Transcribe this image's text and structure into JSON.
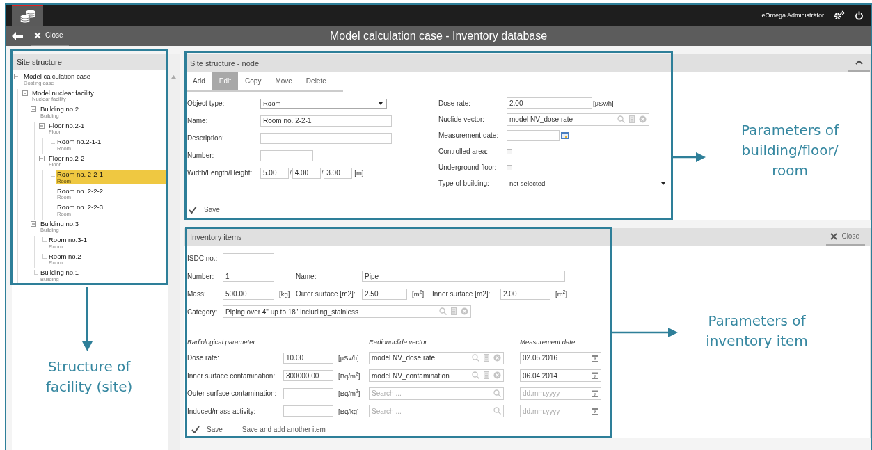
{
  "header": {
    "user": "eOmega Administrátor"
  },
  "toolbar": {
    "close_label": "Close",
    "title": "Model calculation case - Inventory database"
  },
  "tree_panel": {
    "title": "Site structure",
    "nodes": [
      {
        "label": "Model calculation case",
        "type": "Costing case",
        "expanded": true,
        "selected": false,
        "children": [
          {
            "label": "Model nuclear facility",
            "type": "Nuclear facility",
            "expanded": true,
            "selected": false,
            "children": [
              {
                "label": "Building no.2",
                "type": "Building",
                "expanded": true,
                "selected": false,
                "children": [
                  {
                    "label": "Floor no.2-1",
                    "type": "Floor",
                    "expanded": true,
                    "selected": false,
                    "children": [
                      {
                        "label": "Room no.2-1-1",
                        "type": "Room",
                        "selected": false
                      }
                    ]
                  },
                  {
                    "label": "Floor no.2-2",
                    "type": "Floor",
                    "expanded": true,
                    "selected": false,
                    "children": [
                      {
                        "label": "Room no. 2-2-1",
                        "type": "Room",
                        "selected": true
                      },
                      {
                        "label": "Room no. 2-2-2",
                        "type": "Room",
                        "selected": false
                      },
                      {
                        "label": "Room no. 2-2-3",
                        "type": "Room",
                        "selected": false
                      }
                    ]
                  }
                ]
              },
              {
                "label": "Building no.3",
                "type": "Building",
                "expanded": true,
                "selected": false,
                "children": [
                  {
                    "label": "Room no.3-1",
                    "type": "Room",
                    "selected": false
                  },
                  {
                    "label": "Room no.2",
                    "type": "Room",
                    "selected": false
                  }
                ]
              },
              {
                "label": "Building no.1",
                "type": "Building",
                "selected": false
              }
            ]
          }
        ]
      }
    ]
  },
  "node_panel": {
    "title": "Site structure - node",
    "tabs": [
      {
        "label": "Add",
        "selected": false
      },
      {
        "label": "Edit",
        "selected": true
      },
      {
        "label": "Copy",
        "selected": false
      },
      {
        "label": "Move",
        "selected": false
      },
      {
        "label": "Delete",
        "selected": false
      }
    ],
    "left_fields": [
      {
        "kind": "select",
        "label": "Object type:",
        "value": "Room"
      },
      {
        "kind": "text",
        "label": "Name:",
        "value": "Room no. 2-2-1"
      },
      {
        "kind": "text",
        "label": "Description:"
      },
      {
        "kind": "short",
        "label": "Number:"
      },
      {
        "kind": "dims",
        "label": "Width/Length/Height:",
        "values": [
          "5.00",
          "4.00",
          "3.00"
        ],
        "separators": [
          "/",
          "/"
        ],
        "unit": "[m]"
      }
    ],
    "right_fields": [
      {
        "kind": "unit",
        "label": "Dose rate:",
        "value": "2.00",
        "unit": "[µSv/h]"
      },
      {
        "kind": "lookup",
        "label": "Nuclide vector:",
        "value": "model NV_dose rate"
      },
      {
        "kind": "date",
        "label": "Measurement date:"
      },
      {
        "kind": "checkbox",
        "label": "Controlled area:",
        "checked": false
      },
      {
        "kind": "checkbox",
        "label": "Underground floor:",
        "checked": false
      },
      {
        "kind": "select",
        "label": "Type of building:",
        "value": "not selected"
      }
    ],
    "save_label": "Save"
  },
  "inventory_panel": {
    "title": "Inventory items",
    "close_label": "Close",
    "isdc": {
      "label": "ISDC no.:"
    },
    "number": {
      "label": "Number:",
      "value": "1"
    },
    "name": {
      "label": "Name:",
      "value": "Pipe"
    },
    "mass": {
      "label": "Mass:",
      "value": "500.00",
      "unit": "[kg]"
    },
    "outer_surface": {
      "label": "Outer surface [m2]:",
      "value": "2.50",
      "unit": "[m$^{2}$]"
    },
    "inner_surface": {
      "label": "Inner surface [m2]:",
      "value": "2.00",
      "unit": "[m$^{2}$]"
    },
    "category": {
      "label": "Category:",
      "value": "Piping over 4\" up to 18\" including_stainless"
    },
    "radiological": {
      "columns": [
        "Radiological parameter",
        "Radionuclide vector",
        "Measurement date"
      ],
      "rows": [
        {
          "label": "Dose rate:",
          "value": "10.00",
          "unit": "[µSv/h]",
          "vector": "model NV_dose rate",
          "date": "02.05.2016"
        },
        {
          "label": "Inner surface contamination:",
          "value": "300000.00",
          "unit": "[Bq/m$^{2}$]",
          "vector": "model NV_contamination",
          "date": "06.04.2014"
        },
        {
          "label": "Outer surface contamination:",
          "unit": "[Bq/m$^{2}$]",
          "vector_placeholder": "Search ...",
          "date_placeholder": "dd.mm.yyyy"
        },
        {
          "label": "Induced/mass activity:",
          "unit": "[Bq/kg]",
          "vector_placeholder": "Search ...",
          "date_placeholder": "dd.mm.yyyy"
        }
      ]
    },
    "buttons": [
      {
        "kind": "primary",
        "label": "Save"
      },
      {
        "kind": "secondary",
        "label": "Save and add another item"
      }
    ]
  },
  "annotations": [
    {
      "text": "Structure of facility (site)"
    },
    {
      "text": "Parameters of building/floor/ room"
    },
    {
      "text": "Parameters of inventory item"
    }
  ]
}
